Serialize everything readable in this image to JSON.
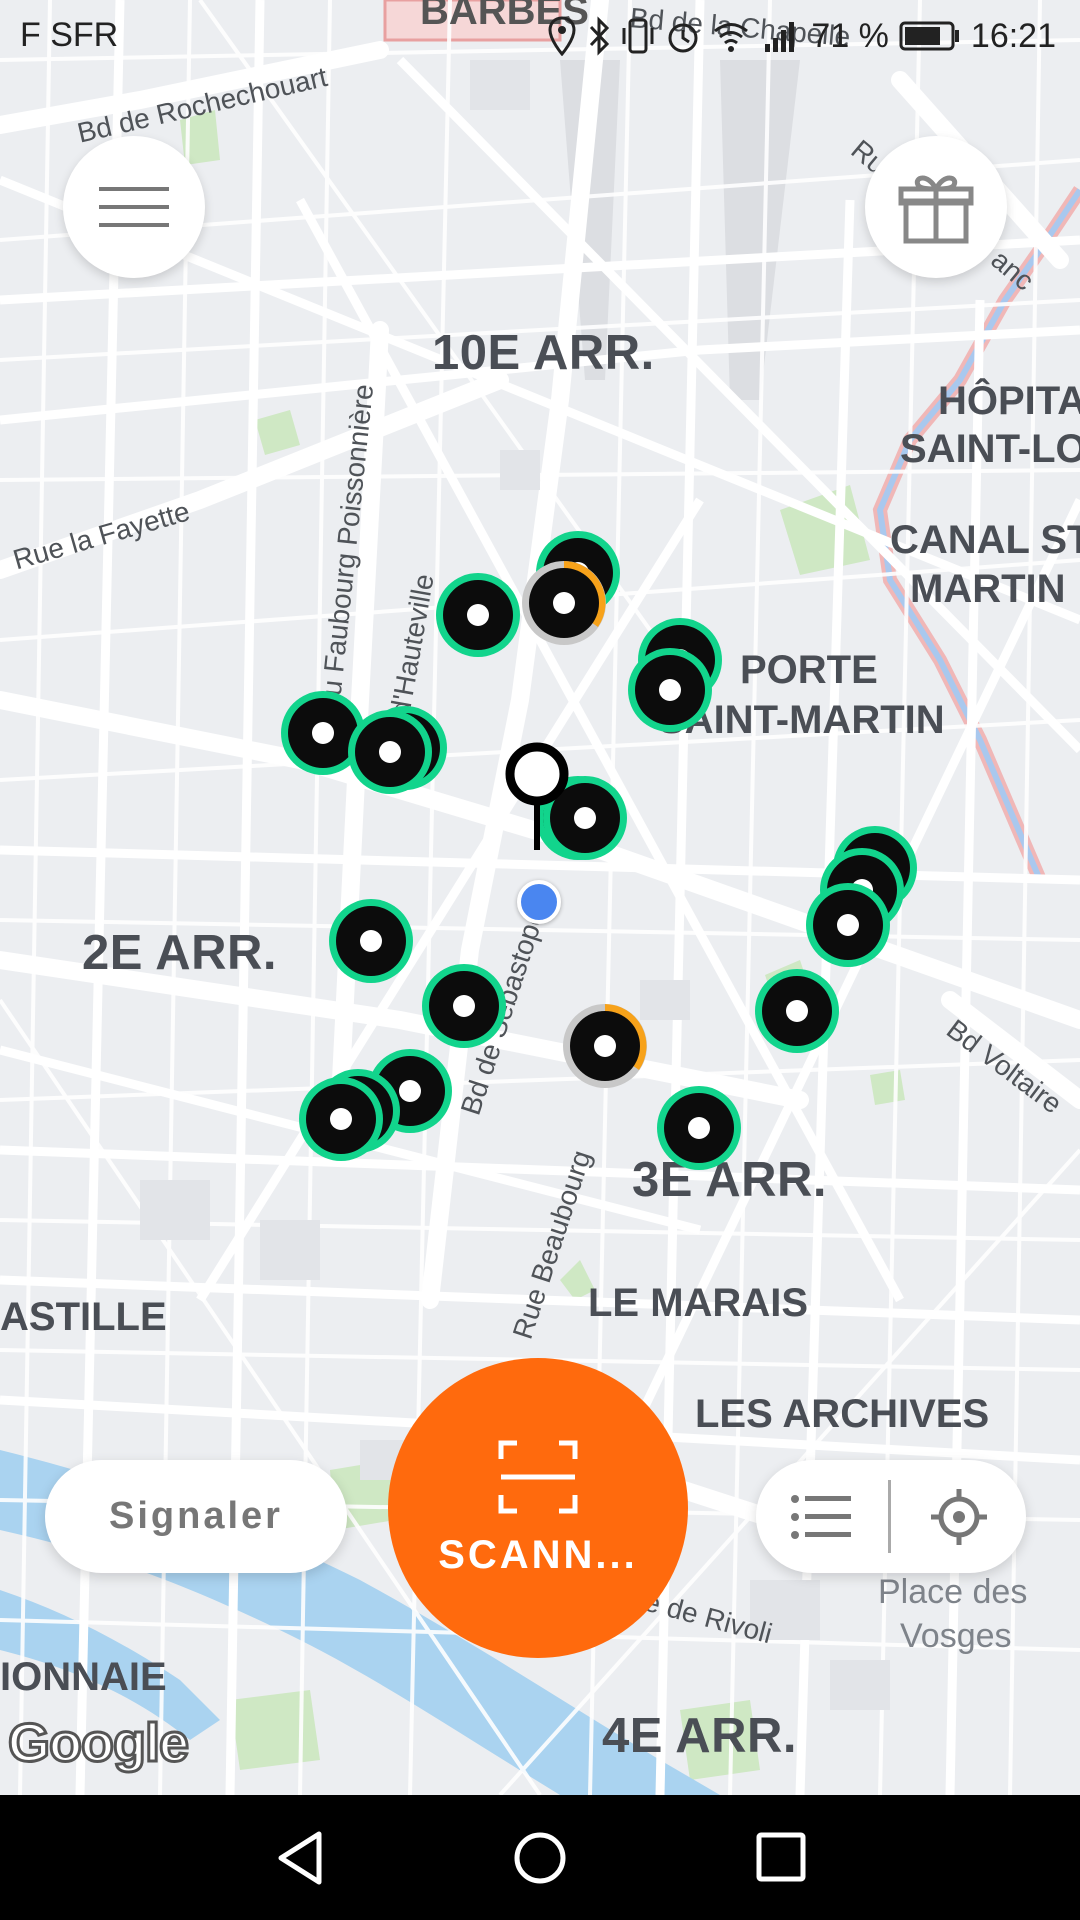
{
  "status_bar": {
    "carrier": "F SFR",
    "battery_percent": "71 %",
    "time": "16:21"
  },
  "map": {
    "districts": [
      {
        "id": "10e",
        "text": "10E ARR."
      },
      {
        "id": "2e",
        "text": "2E ARR."
      },
      {
        "id": "3e",
        "text": "3E ARR."
      },
      {
        "id": "4e",
        "text": "4E ARR."
      }
    ],
    "quarters": {
      "barbes": "BARBÈS",
      "hopital_1": "HÔPITA",
      "hopital_2": "SAINT-LO",
      "canal_1": "CANAL ST",
      "canal_2": "MARTIN",
      "porte_1": "PORTE",
      "porte_2": "SAINT-MARTIN",
      "marais": "LE MARAIS",
      "archives": "LES ARCHIVES",
      "bastille": "ASTILLE",
      "monnaie": "IONNAIE"
    },
    "streets": {
      "rochechouart": "Bd de Rochechouart",
      "chapelle": "Bd de la Chapelle",
      "lafayette": "Rue la Fayette",
      "faubourg": "du Faubourg Poissonnière",
      "hauteville": "d'Hauteville",
      "sebastopol": "Bd de Sébastopol",
      "beaubourg": "Rue Beaubourg",
      "voltaire": "Bd Voltaire",
      "rivoli": "e de Rivoli",
      "ru": "Ru",
      "anc": "anc"
    },
    "places": {
      "vosges_1": "Place des",
      "vosges_2": "Vosges"
    },
    "attribution": "Google"
  },
  "scooters": [
    {
      "type": "normal"
    },
    {
      "type": "normal"
    },
    {
      "type": "low"
    },
    {
      "type": "normal"
    },
    {
      "type": "normal"
    },
    {
      "type": "normal"
    },
    {
      "type": "normal"
    },
    {
      "type": "normal"
    },
    {
      "type": "normal"
    },
    {
      "type": "normal"
    },
    {
      "type": "normal"
    },
    {
      "type": "normal"
    },
    {
      "type": "normal"
    },
    {
      "type": "normal"
    },
    {
      "type": "low"
    },
    {
      "type": "normal"
    },
    {
      "type": "normal"
    },
    {
      "type": "normal"
    },
    {
      "type": "normal"
    },
    {
      "type": "normal"
    },
    {
      "type": "normal"
    }
  ],
  "buttons": {
    "report_label": "Signaler",
    "scan_label": "SCANN..."
  },
  "icons": {
    "menu": "menu-icon",
    "gift": "gift-icon",
    "scan": "scan-icon",
    "list": "list-icon",
    "locate": "locate-icon",
    "back": "back-icon",
    "home": "home-icon",
    "recents": "recents-icon"
  },
  "colors": {
    "accent": "#ff6a0d",
    "scooter_ring": "#12d48c",
    "scooter_low": "#f7a21a",
    "user_location": "#4a86f0"
  }
}
